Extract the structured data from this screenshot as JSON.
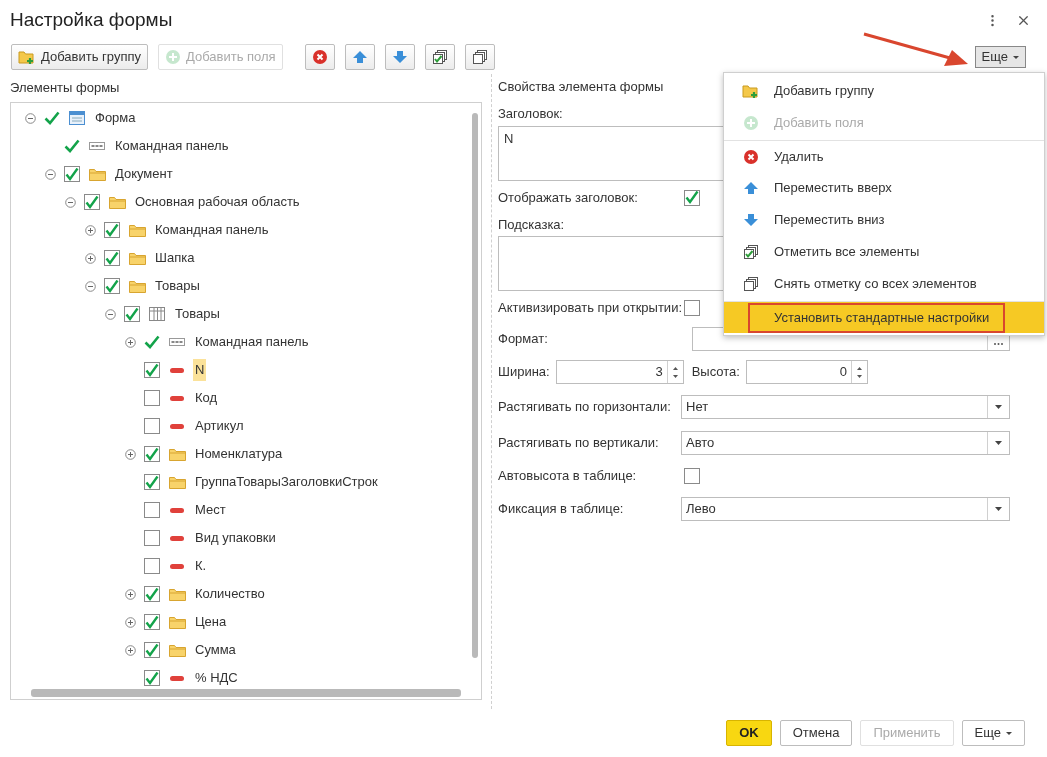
{
  "window": {
    "title": "Настройка формы"
  },
  "toolbar": {
    "buttons": [
      {
        "kind": "add-group",
        "label": "Добавить группу",
        "disabled": false
      },
      {
        "kind": "add-field",
        "label": "Добавить поля",
        "disabled": true
      },
      {
        "kind": "delete",
        "disabled": false
      },
      {
        "kind": "up",
        "disabled": false
      },
      {
        "kind": "down",
        "disabled": false
      },
      {
        "kind": "check-all",
        "disabled": false
      },
      {
        "kind": "uncheck-all",
        "disabled": false
      }
    ],
    "more": {
      "label": "Еще",
      "expanded": true
    }
  },
  "elements": {
    "title": "Элементы формы",
    "tree": [
      {
        "label": "Форма",
        "expanded": true,
        "checkable": false,
        "checked": true,
        "kind": "form",
        "selected": false,
        "children": [
          {
            "label": "Командная панель",
            "checkable": false,
            "checked": true,
            "kind": "command",
            "selected": false
          },
          {
            "label": "Документ",
            "expanded": true,
            "checkable": true,
            "checked": true,
            "kind": "folder",
            "selected": false,
            "children": [
              {
                "label": "Основная рабочая область",
                "expanded": true,
                "checkable": true,
                "checked": true,
                "kind": "folder",
                "selected": false,
                "children": [
                  {
                    "label": "Командная панель",
                    "expanded": false,
                    "checkable": true,
                    "checked": true,
                    "kind": "folder",
                    "selected": false
                  },
                  {
                    "label": "Шапка",
                    "expanded": false,
                    "checkable": true,
                    "checked": true,
                    "kind": "folder",
                    "selected": false
                  },
                  {
                    "label": "Товары",
                    "expanded": true,
                    "checkable": true,
                    "checked": true,
                    "kind": "folder",
                    "selected": false,
                    "children": [
                      {
                        "label": "Товары",
                        "expanded": true,
                        "checkable": true,
                        "checked": true,
                        "kind": "table",
                        "selected": false,
                        "children": [
                          {
                            "label": "Командная панель",
                            "expanded": false,
                            "checkable": false,
                            "checked": true,
                            "kind": "command",
                            "selected": false
                          },
                          {
                            "label": "N",
                            "checkable": true,
                            "checked": true,
                            "kind": "field",
                            "selected": true
                          },
                          {
                            "label": "Код",
                            "checkable": true,
                            "checked": false,
                            "kind": "field",
                            "selected": false
                          },
                          {
                            "label": "Артикул",
                            "checkable": true,
                            "checked": false,
                            "kind": "field",
                            "selected": false
                          },
                          {
                            "label": "Номенклатура",
                            "expanded": false,
                            "checkable": true,
                            "checked": true,
                            "kind": "folder",
                            "selected": false
                          },
                          {
                            "label": "ГруппаТоварыЗаголовкиСтрок",
                            "checkable": true,
                            "checked": true,
                            "kind": "folder",
                            "selected": false
                          },
                          {
                            "label": "Мест",
                            "checkable": true,
                            "checked": false,
                            "kind": "field",
                            "selected": false
                          },
                          {
                            "label": "Вид упаковки",
                            "checkable": true,
                            "checked": false,
                            "kind": "field",
                            "selected": false
                          },
                          {
                            "label": "К.",
                            "checkable": true,
                            "checked": false,
                            "kind": "field",
                            "selected": false
                          },
                          {
                            "label": "Количество",
                            "expanded": false,
                            "checkable": true,
                            "checked": true,
                            "kind": "folder",
                            "selected": false
                          },
                          {
                            "label": "Цена",
                            "expanded": false,
                            "checkable": true,
                            "checked": true,
                            "kind": "folder",
                            "selected": false
                          },
                          {
                            "label": "Сумма",
                            "expanded": false,
                            "checkable": true,
                            "checked": true,
                            "kind": "folder",
                            "selected": false
                          },
                          {
                            "label": "% НДС",
                            "checkable": true,
                            "checked": true,
                            "kind": "field",
                            "selected": false
                          }
                        ]
                      }
                    ]
                  }
                ]
              }
            ]
          }
        ]
      }
    ]
  },
  "properties": {
    "title": "Свойства элемента формы",
    "fields": [
      {
        "kind": "textarea",
        "label": "Заголовок:",
        "value": "N"
      },
      {
        "kind": "checkbox",
        "label": "Отображать заголовок:",
        "checked": true
      },
      {
        "kind": "textarea",
        "label": "Подсказка:"
      },
      {
        "kind": "checkbox",
        "label": "Активизировать при открытии:",
        "checked": false
      },
      {
        "kind": "choice",
        "label": "Формат:"
      },
      {
        "kind": "spinners",
        "items": [
          {
            "label": "Ширина:",
            "value": "3"
          },
          {
            "label": "Высота:",
            "value": "0"
          }
        ]
      },
      {
        "kind": "select",
        "label": "Растягивать по горизонтали:",
        "value": "Нет"
      },
      {
        "kind": "select",
        "label": "Растягивать по вертикали:",
        "value": "Авто"
      },
      {
        "kind": "checkbox",
        "label": "Автовысота в таблице:",
        "checked": false
      },
      {
        "kind": "select",
        "label": "Фиксация в таблице:",
        "value": "Лево"
      }
    ]
  },
  "menu": {
    "items": [
      {
        "kind": "add-group",
        "label": "Добавить группу",
        "disabled": false,
        "separator_before": false,
        "selected": false,
        "outlined": false
      },
      {
        "kind": "add-field",
        "label": "Добавить поля",
        "disabled": true,
        "separator_before": false,
        "selected": false,
        "outlined": false
      },
      {
        "kind": "delete",
        "label": "Удалить",
        "disabled": false,
        "separator_before": true,
        "selected": false,
        "outlined": false
      },
      {
        "kind": "up",
        "label": "Переместить вверх",
        "disabled": false,
        "separator_before": false,
        "selected": false,
        "outlined": false
      },
      {
        "kind": "down",
        "label": "Переместить вниз",
        "disabled": false,
        "separator_before": false,
        "selected": false,
        "outlined": false
      },
      {
        "kind": "check-all",
        "label": "Отметить все элементы",
        "disabled": false,
        "separator_before": false,
        "selected": false,
        "outlined": false
      },
      {
        "kind": "uncheck-all",
        "label": "Снять отметку со всех элементов",
        "disabled": false,
        "separator_before": false,
        "selected": false,
        "outlined": false
      },
      {
        "kind": "plain",
        "label": "Установить стандартные настройки",
        "disabled": false,
        "separator_before": true,
        "selected": true,
        "outlined": true
      }
    ]
  },
  "footer": {
    "buttons": [
      {
        "kind": "primary",
        "label": "OK"
      },
      {
        "kind": "normal",
        "label": "Отмена"
      },
      {
        "kind": "disabled",
        "label": "Применить"
      },
      {
        "kind": "dropdown",
        "label": "Еще"
      }
    ]
  }
}
